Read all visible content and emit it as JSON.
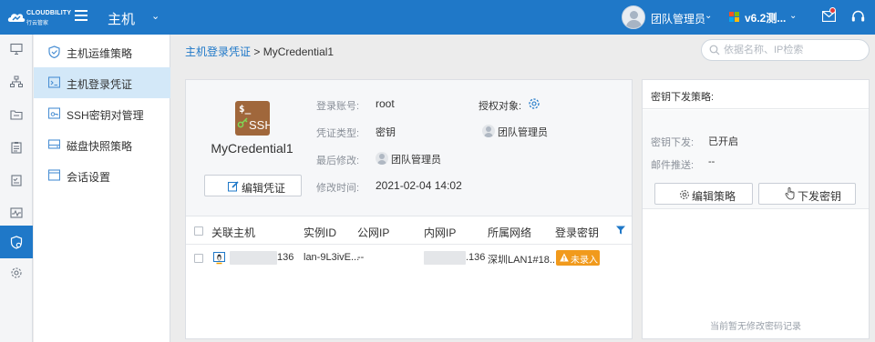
{
  "header": {
    "brand_name": "CLOUDBILITY",
    "brand_sub": "行云管家",
    "module_title": "主机",
    "user_name": "团队管理员",
    "version_label": "v6.2测..."
  },
  "rail": {
    "items": [
      {
        "icon": "monitor-icon"
      },
      {
        "icon": "network-icon"
      },
      {
        "icon": "folder-icon"
      },
      {
        "icon": "clipboard-icon"
      },
      {
        "icon": "checklist-icon"
      },
      {
        "icon": "activity-icon"
      },
      {
        "icon": "shield-gear-icon",
        "active": true
      },
      {
        "icon": "gear-icon"
      }
    ]
  },
  "submenu": {
    "items": [
      {
        "label": "主机运维策略",
        "icon": "shield-check-icon"
      },
      {
        "label": "主机登录凭证",
        "icon": "terminal-icon",
        "active": true
      },
      {
        "label": "SSH密钥对管理",
        "icon": "ssh-key-icon"
      },
      {
        "label": "磁盘快照策略",
        "icon": "disk-snapshot-icon"
      },
      {
        "label": "会话设置",
        "icon": "window-icon"
      }
    ]
  },
  "breadcrumb": {
    "parent": "主机登录凭证",
    "separator": ">",
    "current": "MyCredential1"
  },
  "search": {
    "placeholder": "依据名称、IP检索"
  },
  "credential": {
    "icon_prompt": "$_",
    "icon_text": "SSH",
    "name": "MyCredential1",
    "edit_button": "编辑凭证",
    "fields": {
      "account_label": "登录账号:",
      "account_value": "root",
      "type_label": "凭证类型:",
      "type_value": "密钥",
      "modifier_label": "最后修改:",
      "modifier_value": "团队管理员",
      "time_label": "修改时间:",
      "time_value": "2021-02-04 14:02",
      "authorized_label": "授权对象:",
      "authorized_value": "团队管理员"
    }
  },
  "table": {
    "columns": [
      "关联主机",
      "实例ID",
      "公网IP",
      "内网IP",
      "所属网络",
      "登录密钥"
    ],
    "rows": [
      {
        "host": "136",
        "instance_id": "lan-9L3ivE...",
        "public_ip": "--",
        "private_ip": ".136",
        "network": "深圳LAN1#18...",
        "key_status": "未录入"
      }
    ]
  },
  "key_policy": {
    "title": "密钥下发策略:",
    "dispatch_label": "密钥下发:",
    "dispatch_value": "已开启",
    "mail_label": "邮件推送:",
    "mail_value": "--",
    "edit_button": "编辑策略",
    "send_button": "下发密钥",
    "empty_text": "当前暂无修改密码记录"
  },
  "colors": {
    "primary": "#1f78c8",
    "active_menu_bg": "#d3e8f8",
    "warning": "#f19a1c",
    "credential_icon": "#a0673b"
  }
}
